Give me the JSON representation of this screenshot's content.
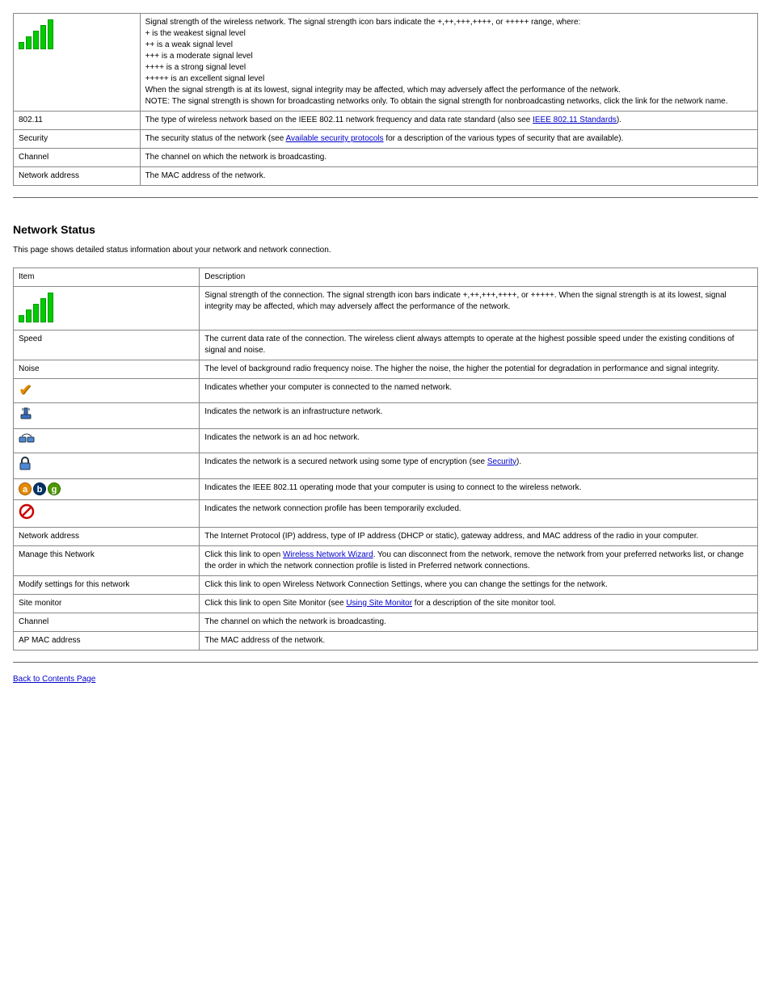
{
  "table1": {
    "rows": [
      {
        "icon": "signal",
        "desc_lines": [
          "Signal strength of the wireless network. The signal strength icon bars indicate the +,++,+++,++++, or +++++ range, where:",
          "+ is the weakest signal level",
          "++ is a weak signal level",
          "+++ is a moderate signal level",
          "++++ is a strong signal level",
          "+++++ is an excellent signal level",
          "When the signal strength is at its lowest, signal integrity may be affected, which may adversely affect the performance of the network.",
          "NOTE: The signal strength is shown for broadcasting networks only. To obtain the signal strength for nonbroadcasting networks, click the link for the network name."
        ]
      },
      {
        "label": "802.11",
        "desc": "The type of wireless network based on the IEEE 802.11 network frequency and data rate standard (also see ",
        "link_text": "IEEE 802.11 Standards",
        "desc_after": ")."
      },
      {
        "label": "Security",
        "desc": "The security status of the network (see ",
        "link_text": "Available security protocols",
        "desc_after": " for a description of the various types of security that are available)."
      },
      {
        "label": "Channel",
        "desc": "The channel on which the network is broadcasting."
      },
      {
        "label": "Network address",
        "desc": "The MAC address of the network."
      }
    ]
  },
  "section": {
    "heading": "Network Status",
    "desc": "This page shows detailed status information about your network and network connection."
  },
  "table2": {
    "header": {
      "item": "Item",
      "description": "Description"
    },
    "rows": [
      {
        "icon": "signal-sm",
        "desc": "Signal strength of the connection. The signal strength icon bars indicate +,++,+++,++++, or +++++. When the signal strength is at its lowest, signal integrity may be affected, which may adversely affect the performance of the network."
      },
      {
        "label": "Speed",
        "desc": "The current data rate of the connection. The wireless client always attempts to operate at the highest possible speed under the existing conditions of signal and noise."
      },
      {
        "label": "Noise",
        "desc": "The level of background radio frequency noise. The higher the noise, the higher the potential for degradation in performance and signal integrity."
      },
      {
        "icon": "check",
        "desc": "Indicates whether your computer is connected to the named network."
      },
      {
        "icon": "infra",
        "desc": "Indicates the network is an infrastructure network."
      },
      {
        "icon": "adhoc",
        "desc": "Indicates the network is an ad hoc network."
      },
      {
        "icon": "lock",
        "desc_before": "Indicates the network is a secured network using some type of encryption (see ",
        "link_text": "Security",
        "desc_after": ")."
      },
      {
        "icon": "abg",
        "desc": "Indicates the IEEE 802.11 operating mode that your computer is using to connect to the wireless network."
      },
      {
        "icon": "excluded",
        "desc": "Indicates the network connection profile has been temporarily excluded."
      },
      {
        "label": "Network address",
        "desc": "The Internet Protocol (IP) address, type of IP address (DHCP or static), gateway address, and MAC address of the radio in your computer."
      },
      {
        "label": "Manage this Network",
        "desc_before": "Click this link to open ",
        "link_text": "Wireless Network Wizard",
        "desc_after": ". You can disconnect from the network, remove the network from your preferred networks list, or change the order in which the network connection profile is listed in Preferred network connections."
      },
      {
        "label": "Modify settings for this network",
        "desc": "Click this link to open Wireless Network Connection Settings, where you can change the settings for the network."
      },
      {
        "label": "Site monitor",
        "desc_before": "Click this link to open Site Monitor (see ",
        "link_text": "Using Site Monitor",
        "desc_after": " for a description of the site monitor tool."
      },
      {
        "label": "Channel",
        "desc": "The channel on which the network is broadcasting."
      },
      {
        "label": "AP MAC address",
        "desc": "The MAC address of the network."
      }
    ]
  },
  "back": "Back to Contents Page"
}
